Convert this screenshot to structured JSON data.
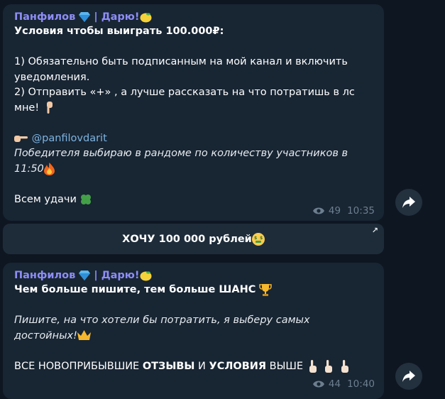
{
  "message1": {
    "sender_name": "Панфилов",
    "sender_separator": "| Дарю!",
    "title": "Условия чтобы выиграть 100.000₽:",
    "line1a": "1) Обязательно быть подписанным на мой канал и включить",
    "line1b": "уведомления.",
    "line2a": "2) Отправить «+» , а лучше рассказать на что потратишь в лс",
    "line2b": "мне!",
    "link": "@panfilovdarit",
    "italic_a": "Победителя выбираю в рандоме по количеству участников в",
    "italic_b": "11:50",
    "closing": "Всем удачи",
    "views": "49",
    "time": "10:35"
  },
  "keyboard_button": {
    "label": "ХОЧУ 100 000 рублей",
    "corner_icon": "arrow-up-right-icon"
  },
  "message2": {
    "sender_name": "Панфилов",
    "sender_separator": "| Дарю!",
    "headline": "Чем больше пишите, тем больше ШАНС",
    "italic_a": "Пишите, на что хотели бы потратить, я выберу самых",
    "italic_b": "достойных!",
    "caps_a": "ВСЕ НОВОПРИБЫВШИЕ ",
    "caps_b": "ОТЗЫВЫ",
    "caps_c": " И ",
    "caps_d": "УСЛОВИЯ",
    "caps_e": " ВЫШЕ",
    "views": "44",
    "time": "10:40"
  },
  "icons": {
    "share": "share-arrow-icon",
    "views": "eye-icon",
    "gem": "gem-icon",
    "lemon": "lemon-icon",
    "hand_down": "hand-pointing-down-icon",
    "hand_right": "hand-pointing-right-icon",
    "fire": "fire-icon",
    "clover": "four-leaf-clover-icon",
    "money_face": "money-mouth-face-icon",
    "trophy": "trophy-icon",
    "crown": "crown-icon",
    "hand_up": "hand-pointing-up-icon"
  },
  "colors": {
    "background": "#0e1621",
    "bubble": "#182533",
    "sender": "#8e8df6",
    "link": "#7db4e0",
    "meta": "#6d7f8f"
  }
}
